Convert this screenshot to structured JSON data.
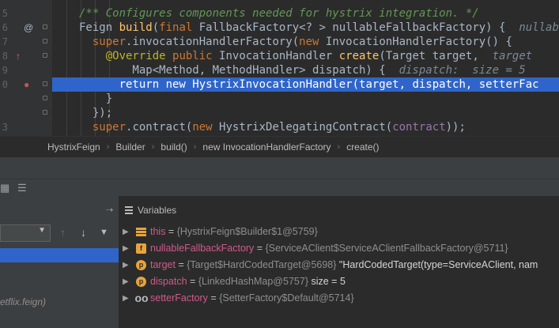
{
  "editor": {
    "line_numbers": [
      "5",
      "6",
      "7",
      "8",
      "9",
      "0",
      "",
      "",
      "3"
    ],
    "lines": [
      {
        "tokens": [
          {
            "t": "/** Configures components needed for hystrix integration. */",
            "c": "cm"
          }
        ]
      },
      {
        "tokens": [
          {
            "t": "Feign ",
            "c": "tx"
          },
          {
            "t": "build",
            "c": "fn"
          },
          {
            "t": "(",
            "c": "tx"
          },
          {
            "t": "final ",
            "c": "kw"
          },
          {
            "t": "FallbackFactory<? > nullableFallbackFactory) {  ",
            "c": "tx"
          },
          {
            "t": "nullab",
            "c": "hint"
          }
        ]
      },
      {
        "tokens": [
          {
            "t": "  super",
            "c": "kw"
          },
          {
            "t": ".invocationHandlerFactory(",
            "c": "tx"
          },
          {
            "t": "new ",
            "c": "kw"
          },
          {
            "t": "InvocationHandlerFactory() {",
            "c": "tx"
          }
        ]
      },
      {
        "tokens": [
          {
            "t": "    @Override ",
            "c": "an"
          },
          {
            "t": "public ",
            "c": "kw"
          },
          {
            "t": "InvocationHandler ",
            "c": "tx"
          },
          {
            "t": "create",
            "c": "fn"
          },
          {
            "t": "(Target target,  ",
            "c": "tx"
          },
          {
            "t": "target",
            "c": "hint"
          }
        ]
      },
      {
        "tokens": [
          {
            "t": "        Map<Method, MethodHandler> dispatch) {  ",
            "c": "tx"
          },
          {
            "t": "dispatch:  size = 5",
            "c": "hint"
          }
        ]
      },
      {
        "tokens": [
          {
            "t": "      return ",
            "c": "kw"
          },
          {
            "t": "new ",
            "c": "kw"
          },
          {
            "t": "HystrixInvocationHandler(target, dispatch, ",
            "c": "tx"
          },
          {
            "t": "setterFac",
            "c": "fld"
          }
        ],
        "highlighted": true
      },
      {
        "tokens": [
          {
            "t": "    }",
            "c": "tx"
          }
        ]
      },
      {
        "tokens": [
          {
            "t": "  });",
            "c": "tx"
          }
        ]
      },
      {
        "tokens": [
          {
            "t": "  super",
            "c": "kw"
          },
          {
            "t": ".contract(",
            "c": "tx"
          },
          {
            "t": "new ",
            "c": "kw"
          },
          {
            "t": "HystrixDelegatingContract(",
            "c": "tx"
          },
          {
            "t": "contract",
            "c": "fld"
          },
          {
            "t": "));",
            "c": "tx"
          }
        ]
      }
    ]
  },
  "breadcrumb": [
    "HystrixFeign",
    "Builder",
    "build()",
    "new InvocationHandlerFactory",
    "create()"
  ],
  "breadcrumb_separator": "›",
  "frames": {
    "package_hint": "etflix.feign)"
  },
  "variables": {
    "title": "Variables",
    "rows": [
      {
        "icon": "lines3",
        "icon_text": "",
        "name": "this",
        "value": "{HystrixFeign$Builder$1@5759}",
        "extra": ""
      },
      {
        "icon": "f",
        "icon_text": "f",
        "name": "nullableFallbackFactory",
        "value": "{ServiceAClient$ServiceAClientFallbackFactory@5711}",
        "extra": ""
      },
      {
        "icon": "p",
        "icon_text": "p",
        "name": "target",
        "value": "{Target$HardCodedTarget@5698}",
        "extra": "\"HardCodedTarget(type=ServiceAClient, nam"
      },
      {
        "icon": "p",
        "icon_text": "p",
        "name": "dispatch",
        "value": "{LinkedHashMap@5757}",
        "extra": " size = 5"
      },
      {
        "icon": "oo",
        "icon_text": "oo",
        "name": "setterFactory",
        "value": "{SetterFactory$Default@5714}",
        "extra": ""
      }
    ]
  },
  "icons": {
    "override": "at-sign-icon",
    "breakpoint": "breakpoint-icon",
    "implement": "implement-arrow-icon"
  },
  "colors": {
    "selection": "#2f65ca",
    "keyword": "#cc7832",
    "comment": "#629755",
    "var_name": "#d05a8a"
  }
}
